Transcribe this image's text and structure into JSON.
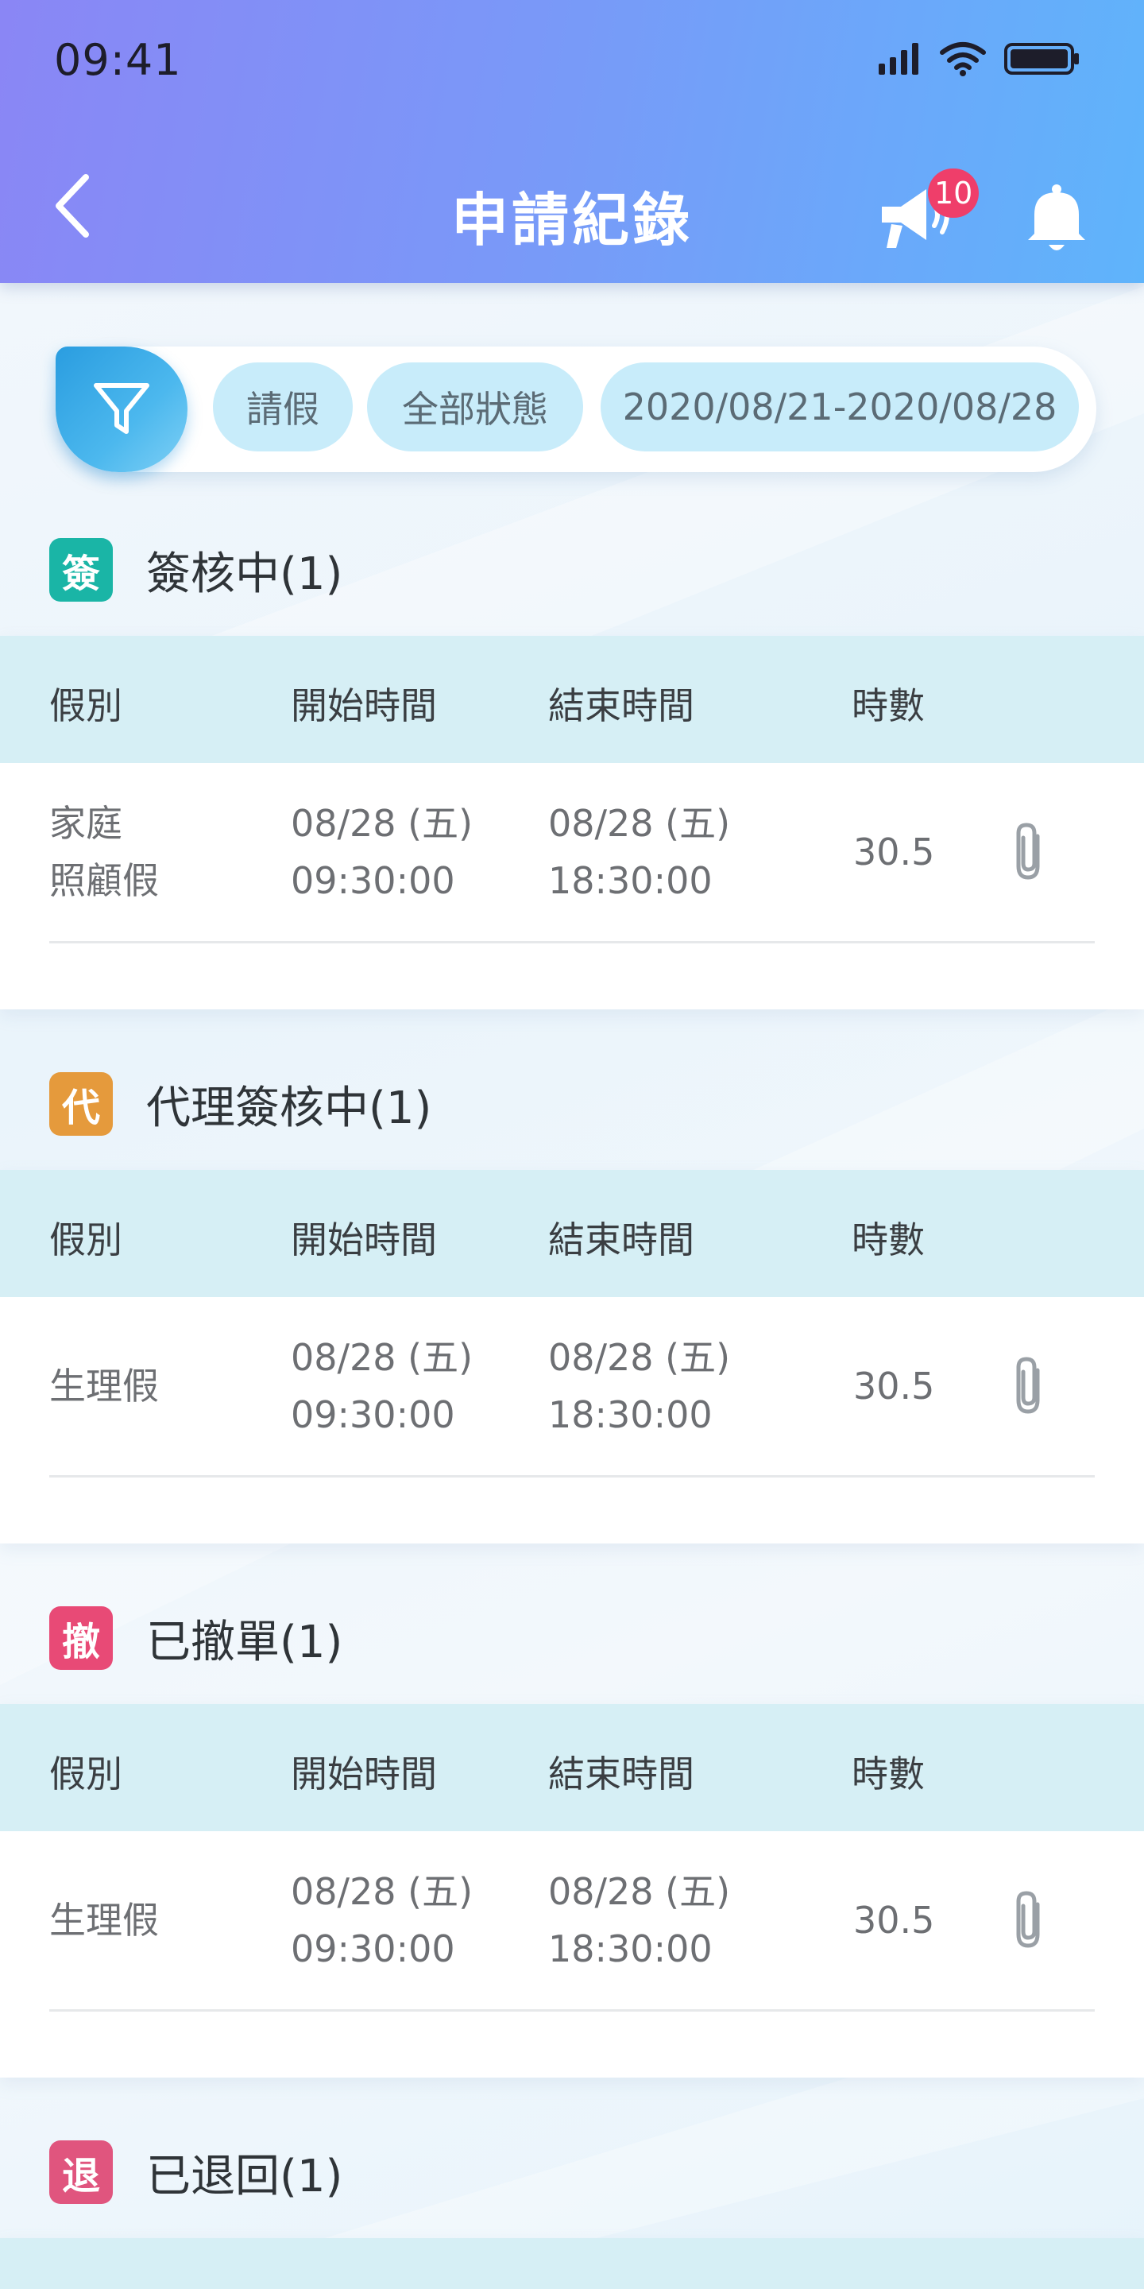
{
  "status_bar": {
    "time": "09:41"
  },
  "nav": {
    "title": "申請紀錄",
    "announcement_badge": "10"
  },
  "filters": {
    "type": "請假",
    "status": "全部狀態",
    "date_range": "2020/08/21-2020/08/28"
  },
  "columns": {
    "type": "假別",
    "start": "開始時間",
    "end": "結束時間",
    "hours": "時數"
  },
  "sections": [
    {
      "icon": "簽",
      "color": "#1ab5a6",
      "title": "簽核中(1)",
      "row": {
        "type_line1": "家庭",
        "type_line2": "照顧假",
        "start_date": "08/28 (五)",
        "start_time": "09:30:00",
        "end_date": "08/28 (五)",
        "end_time": "18:30:00",
        "hours": "30.5"
      }
    },
    {
      "icon": "代",
      "color": "#e59a3c",
      "title": "代理簽核中(1)",
      "row": {
        "type_line1": "生理假",
        "type_line2": "",
        "start_date": "08/28 (五)",
        "start_time": "09:30:00",
        "end_date": "08/28 (五)",
        "end_time": "18:30:00",
        "hours": "30.5"
      }
    },
    {
      "icon": "撤",
      "color": "#e84a76",
      "title": "已撤單(1)",
      "row": {
        "type_line1": "生理假",
        "type_line2": "",
        "start_date": "08/28 (五)",
        "start_time": "09:30:00",
        "end_date": "08/28 (五)",
        "end_time": "18:30:00",
        "hours": "30.5"
      }
    },
    {
      "icon": "退",
      "color": "#e0557e",
      "title": "已退回(1)"
    }
  ]
}
